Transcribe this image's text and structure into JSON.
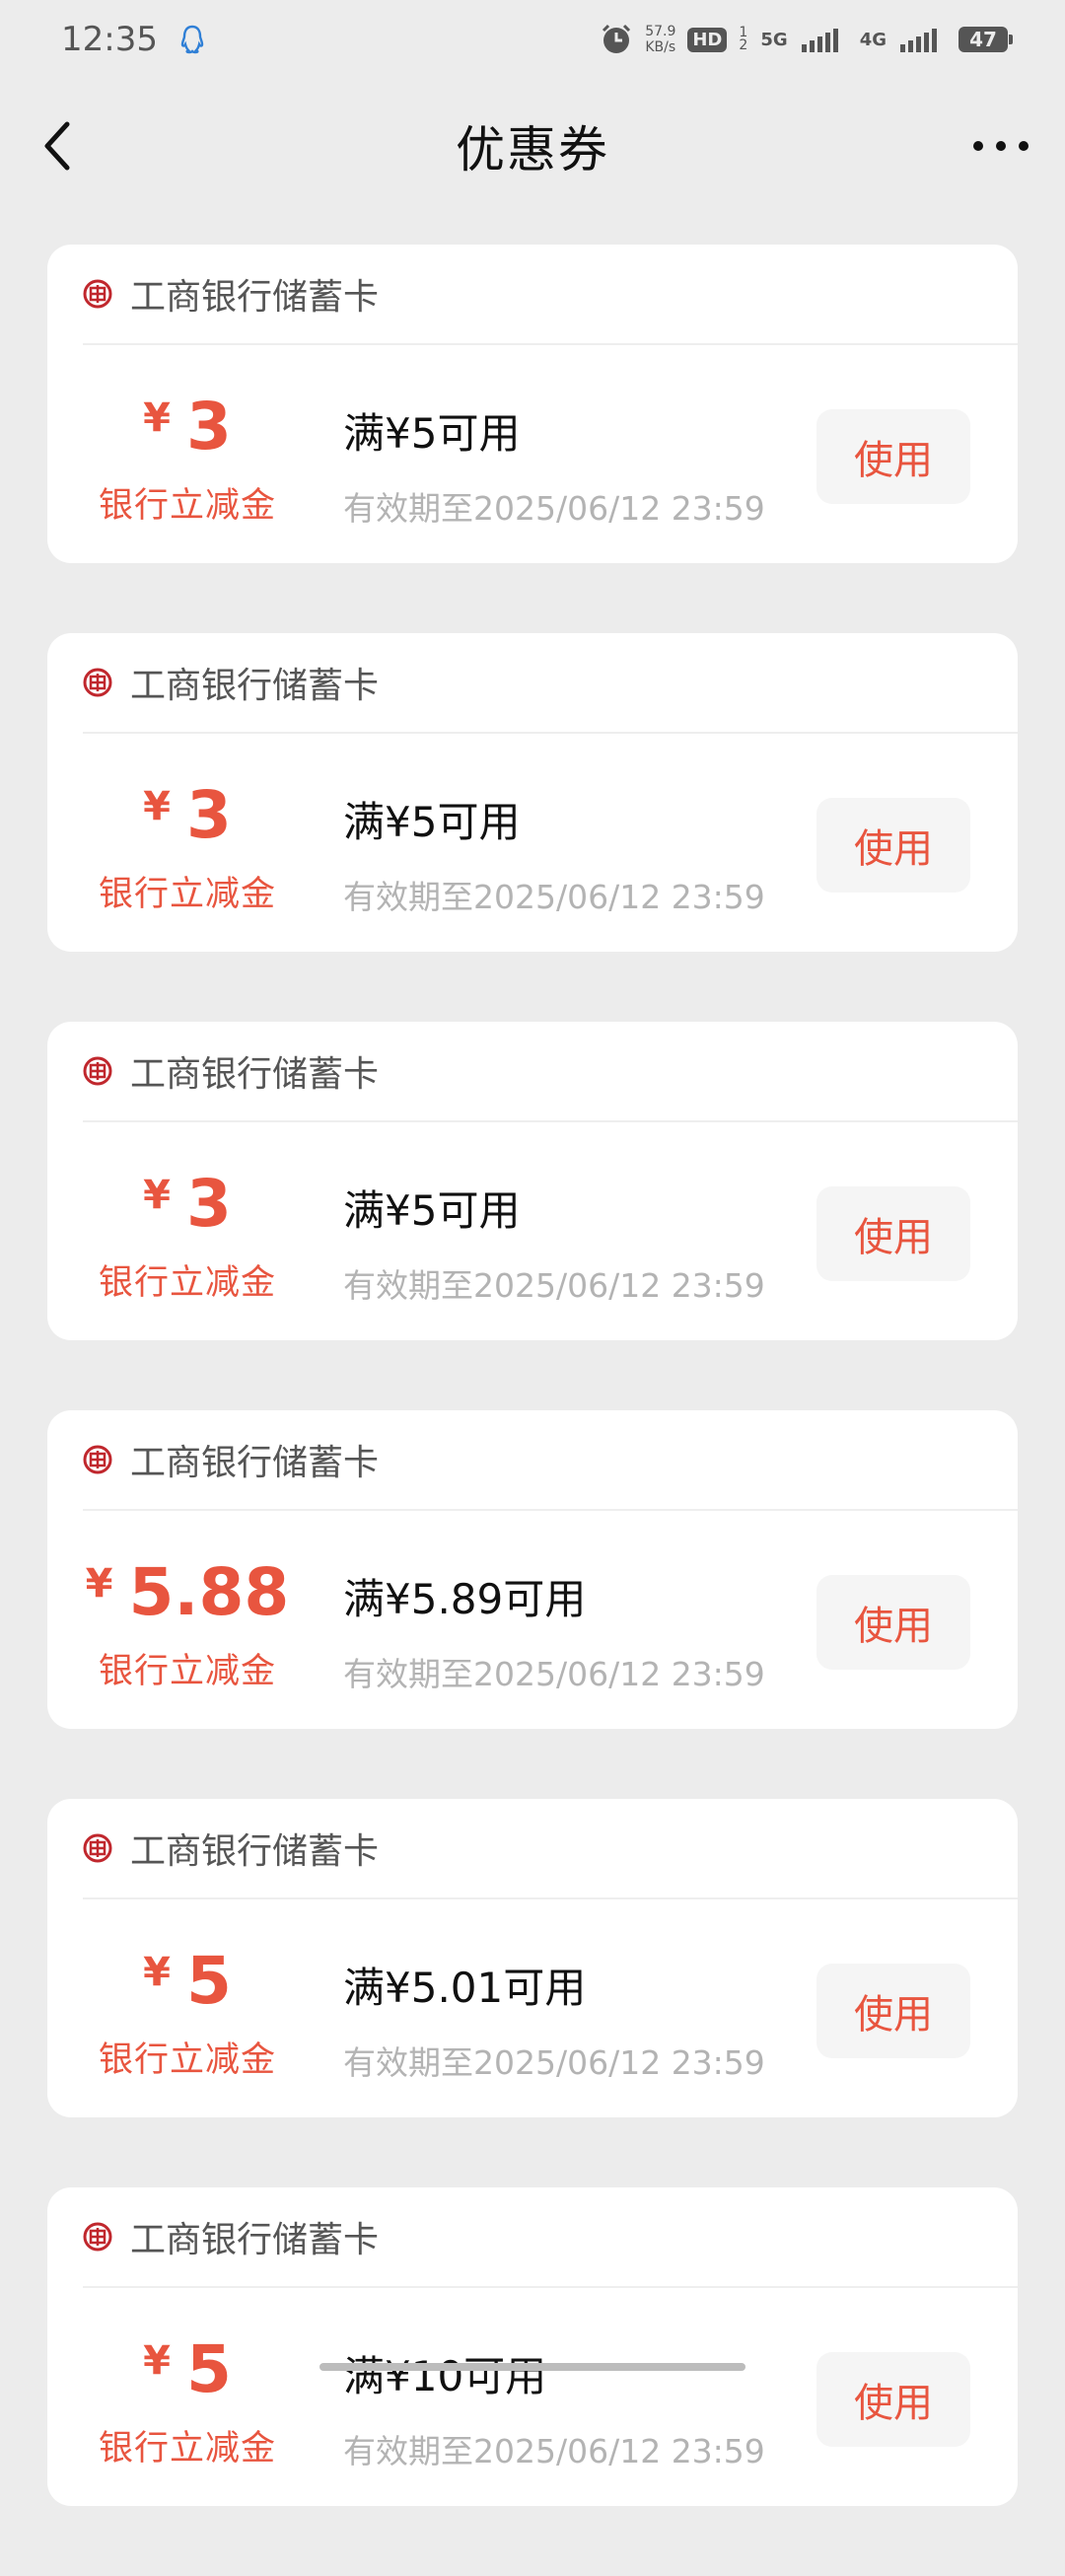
{
  "status_bar": {
    "time": "12:35",
    "net_speed_value": "57.9",
    "net_speed_unit": "KB/s",
    "hd_label": "HD",
    "hd_sub": "1 2",
    "network_1": "5G",
    "network_2": "4G",
    "battery": "47"
  },
  "header": {
    "title": "优惠券"
  },
  "coupons": [
    {
      "bank": "工商银行储蓄卡",
      "currency": "¥",
      "amount": "3",
      "label": "银行立减金",
      "threshold": "满¥5可用",
      "expiry": "有效期至2025/06/12 23:59",
      "button": "使用"
    },
    {
      "bank": "工商银行储蓄卡",
      "currency": "¥",
      "amount": "3",
      "label": "银行立减金",
      "threshold": "满¥5可用",
      "expiry": "有效期至2025/06/12 23:59",
      "button": "使用"
    },
    {
      "bank": "工商银行储蓄卡",
      "currency": "¥",
      "amount": "3",
      "label": "银行立减金",
      "threshold": "满¥5可用",
      "expiry": "有效期至2025/06/12 23:59",
      "button": "使用"
    },
    {
      "bank": "工商银行储蓄卡",
      "currency": "¥",
      "amount": "5.88",
      "label": "银行立减金",
      "threshold": "满¥5.89可用",
      "expiry": "有效期至2025/06/12 23:59",
      "button": "使用"
    },
    {
      "bank": "工商银行储蓄卡",
      "currency": "¥",
      "amount": "5",
      "label": "银行立减金",
      "threshold": "满¥5.01可用",
      "expiry": "有效期至2025/06/12 23:59",
      "button": "使用"
    },
    {
      "bank": "工商银行储蓄卡",
      "currency": "¥",
      "amount": "5",
      "label": "银行立减金",
      "threshold": "满¥10可用",
      "expiry": "有效期至2025/06/12 23:59",
      "button": "使用"
    }
  ],
  "colors": {
    "accent": "#e8553f",
    "bank_logo": "#c0272d",
    "background": "#ececec"
  }
}
